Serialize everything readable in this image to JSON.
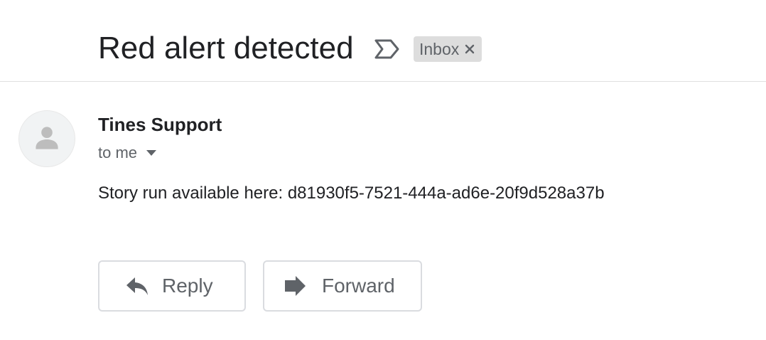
{
  "email": {
    "subject": "Red alert detected",
    "labels": [
      {
        "name": "Inbox",
        "removable": true
      }
    ],
    "sender": "Tines Support",
    "recipient_summary": "to me",
    "body": "Story run available here: d81930f5-7521-444a-ad6e-20f9d528a37b"
  },
  "actions": {
    "reply_label": "Reply",
    "forward_label": "Forward"
  },
  "icons": {
    "important": "label-important-outline-icon",
    "chip_close": "close-icon",
    "avatar": "person-icon",
    "recipient_details": "caret-down-icon",
    "reply": "reply-icon",
    "forward": "forward-arrow-icon"
  },
  "colors": {
    "text_primary": "#202124",
    "text_secondary": "#5f6368",
    "chip_background": "#dddddd",
    "button_border": "#dadce0",
    "avatar_background": "#f1f3f4",
    "avatar_glyph": "#bdbdbd"
  }
}
